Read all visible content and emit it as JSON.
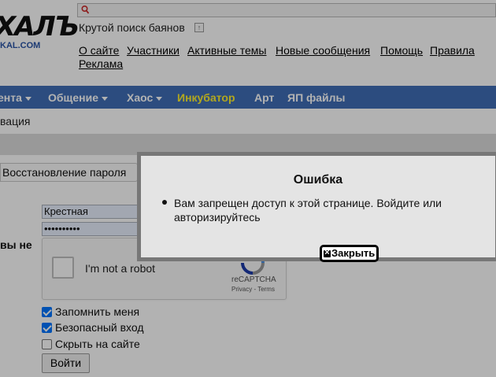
{
  "header": {
    "logo_text": "ХАЛЪ",
    "logo_url_text": "KAL.COM",
    "search": {
      "value": "",
      "icon": "search-icon"
    },
    "tagline": "Крутой поиск баянов",
    "tagline_toggle": "↑",
    "links": [
      "О сайте",
      "Участники",
      "Активные темы",
      "Новые сообщения",
      "Помощь",
      "Правила",
      "Реклама"
    ]
  },
  "nav": {
    "items": [
      {
        "label": "ента",
        "dropdown": true
      },
      {
        "label": "Общение",
        "dropdown": true
      },
      {
        "label": "Хаос",
        "dropdown": true
      },
      {
        "label": "Инкубатор",
        "dropdown": false,
        "highlight": true
      },
      {
        "label": "Арт",
        "dropdown": false
      },
      {
        "label": "ЯП файлы",
        "dropdown": false
      }
    ],
    "bg_color": "#3f6eb7",
    "highlight_color": "#ffef2b"
  },
  "breadcrumb": "вация",
  "login": {
    "tab_label": "Восстановление пароля",
    "side_label": "вы не",
    "username": "Крестная",
    "password": "••••••••••",
    "captcha": {
      "label": "I'm not a robot",
      "brand": "reCAPTCHA",
      "terms": "Privacy - Terms"
    },
    "checkboxes": [
      {
        "label": "Запомнить меня",
        "checked": true
      },
      {
        "label": "Безопасный вход",
        "checked": true
      },
      {
        "label": "Скрыть на сайте",
        "checked": false
      }
    ],
    "submit_label": "Войти"
  },
  "dialog": {
    "title": "Ошибка",
    "message": "Вам запрещен доступ к этой странице. Войдите или авторизируйтесь",
    "close_label": "Закрыть"
  }
}
